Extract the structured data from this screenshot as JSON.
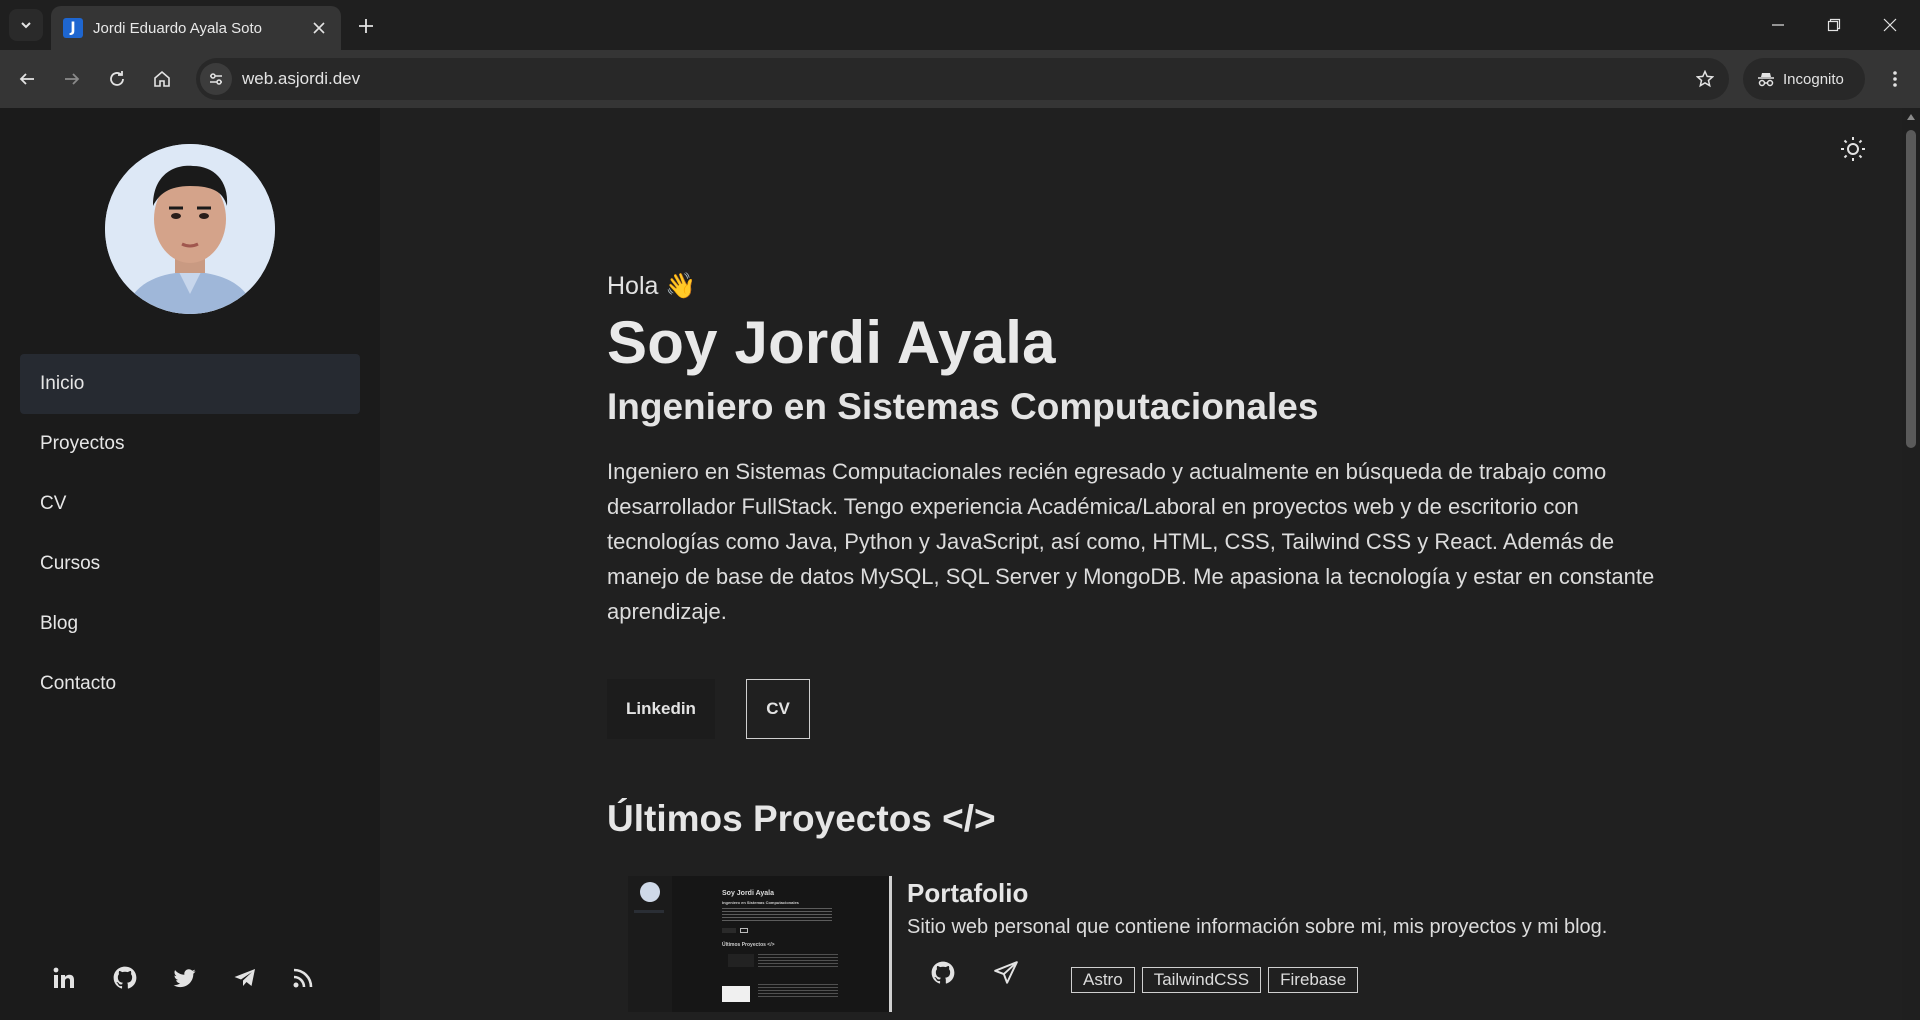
{
  "browser": {
    "tab_title": "Jordi Eduardo Ayala Soto",
    "url": "web.asjordi.dev",
    "incognito_label": "Incognito"
  },
  "sidebar": {
    "items": [
      {
        "label": "Inicio",
        "active": true
      },
      {
        "label": "Proyectos"
      },
      {
        "label": "CV"
      },
      {
        "label": "Cursos"
      },
      {
        "label": "Blog"
      },
      {
        "label": "Contacto"
      }
    ],
    "social_icons": [
      "linkedin-icon",
      "github-icon",
      "twitter-icon",
      "telegram-icon",
      "rss-icon"
    ]
  },
  "main": {
    "greeting": "Hola 👋",
    "name": "Soy Jordi Ayala",
    "role": "Ingeniero en Sistemas Computacionales",
    "description": "Ingeniero en Sistemas Computacionales recién egresado y actualmente en búsqueda de trabajo como desarrollador FullStack. Tengo experiencia Académica/Laboral en proyectos web y de escritorio con tecnologías como Java, Python y JavaScript, así como, HTML, CSS, Tailwind CSS y React. Además de manejo de base de datos MySQL, SQL Server y MongoDB. Me apasiona la tecnología y estar en constante aprendizaje.",
    "buttons": {
      "linkedin": "Linkedin",
      "cv": "CV"
    },
    "projects_title": "Últimos Proyectos </>",
    "project": {
      "title": "Portafolio",
      "description": "Sitio web personal que contiene información sobre mi, mis proyectos y mi blog.",
      "tags": [
        "Astro",
        "TailwindCSS",
        "Firebase"
      ],
      "thumb": {
        "name": "Soy Jordi Ayala",
        "role": "Ingeniero en Sistemas Computacionales",
        "section": "Últimos Proyectos </>"
      }
    }
  },
  "colors": {
    "background": "#202020",
    "sidebar": "#1b1b1b",
    "active_nav": "#262a31",
    "text": "#e6e6e6"
  }
}
